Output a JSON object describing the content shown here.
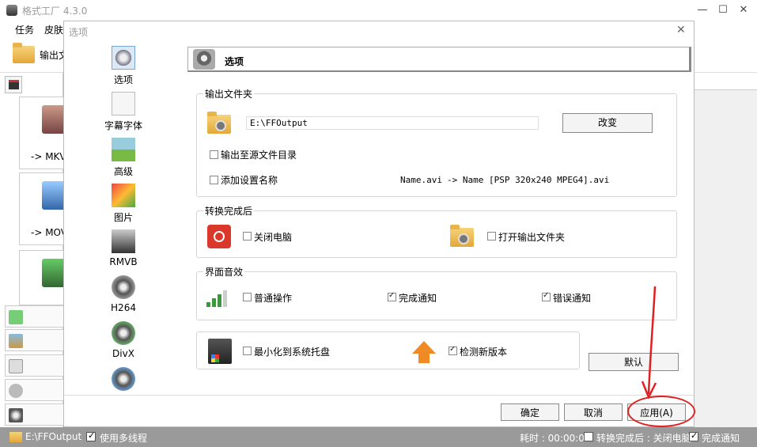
{
  "app": {
    "title": "格式工厂 4.3.0",
    "menu": [
      "任务",
      "皮肤"
    ],
    "toolbar_label": "输出文",
    "format_cards": [
      "-> MKV",
      "-> MOV",
      ""
    ]
  },
  "dialog": {
    "title": "选项",
    "nav": [
      {
        "label": "选项",
        "icon": "options-icon"
      },
      {
        "label": "字幕字体",
        "icon": "subtitle-font-icon"
      },
      {
        "label": "高级",
        "icon": "advanced-icon"
      },
      {
        "label": "图片",
        "icon": "picture-icon"
      },
      {
        "label": "RMVB",
        "icon": "rmvb-icon"
      },
      {
        "label": "H264",
        "icon": "h264-icon"
      },
      {
        "label": "DivX",
        "icon": "divx-icon"
      },
      {
        "label": "",
        "icon": "film-icon"
      }
    ],
    "section_title": "选项",
    "output_folder": {
      "group_title": "输出文件夹",
      "path": "E:\\FFOutput",
      "change_label": "改变",
      "to_source_label": "输出至源文件目录",
      "to_source_checked": false,
      "add_name_label": "添加设置名称",
      "add_name_checked": false,
      "name_example_left": "Name.avi",
      "name_example_right": "-> Name [PSP 320x240 MPEG4].avi"
    },
    "after_convert": {
      "group_title": "转换完成后",
      "shutdown_label": "关闭电脑",
      "shutdown_checked": false,
      "open_folder_label": "打开输出文件夹",
      "open_folder_checked": false
    },
    "sound": {
      "group_title": "界面音效",
      "normal_label": "普通操作",
      "normal_checked": false,
      "complete_label": "完成通知",
      "complete_checked": true,
      "error_label": "错误通知",
      "error_checked": true
    },
    "misc": {
      "tray_label": "最小化到系统托盘",
      "tray_checked": false,
      "update_label": "检测新版本",
      "update_checked": true
    },
    "default_label": "默认",
    "ok_label": "确定",
    "cancel_label": "取消",
    "apply_label": "应用(A)"
  },
  "status": {
    "folder": "E:\\FFOutput",
    "multithread_label": "使用多线程",
    "multithread_checked": true,
    "elapsed": "耗时 : 00:00:00",
    "after_done": "转换完成后 : 关闭电脑",
    "after_done_checked": false,
    "notify_label": "完成通知",
    "notify_checked": true
  },
  "colors": {
    "annotation": "#e02020",
    "statusbar": "#9a9a9a"
  }
}
